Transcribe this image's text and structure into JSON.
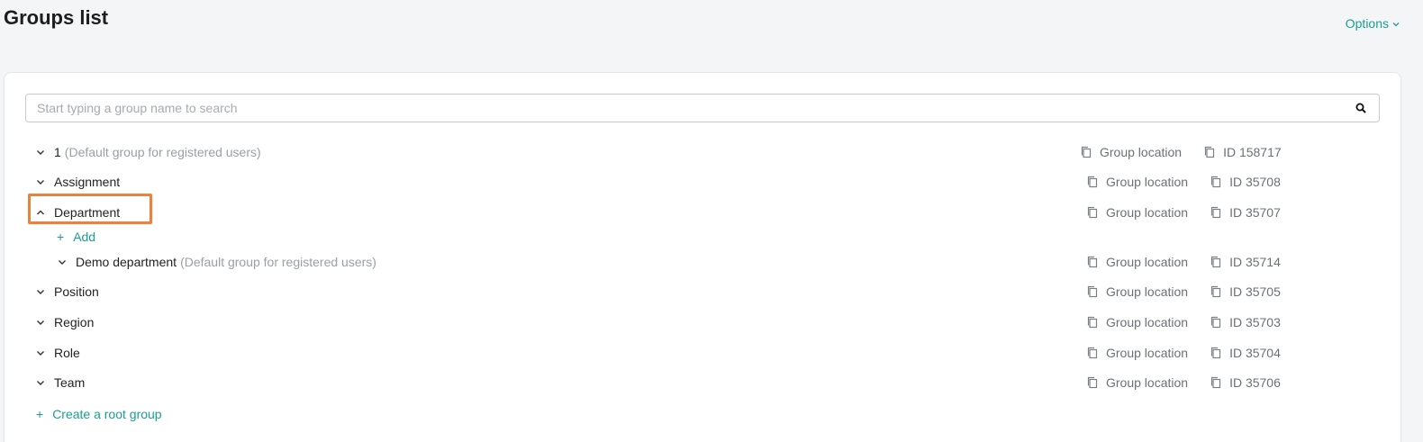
{
  "header": {
    "title": "Groups list",
    "options_label": "Options"
  },
  "search": {
    "placeholder": "Start typing a group name to search",
    "value": ""
  },
  "groups": [
    {
      "name": "1",
      "desc": "(Default group for registered users)",
      "location": "Group location",
      "id": "ID 158717",
      "expanded": false
    },
    {
      "name": "Assignment",
      "desc": "",
      "location": "Group location",
      "id": "ID 35708",
      "expanded": false
    },
    {
      "name": "Department",
      "desc": "",
      "location": "Group location",
      "id": "ID 35707",
      "expanded": true
    },
    {
      "name": "Demo department",
      "desc": "(Default group for registered users)",
      "location": "Group location",
      "id": "ID 35714",
      "expanded": false
    },
    {
      "name": "Position",
      "desc": "",
      "location": "Group location",
      "id": "ID 35705",
      "expanded": false
    },
    {
      "name": "Region",
      "desc": "",
      "location": "Group location",
      "id": "ID 35703",
      "expanded": false
    },
    {
      "name": "Role",
      "desc": "",
      "location": "Group location",
      "id": "ID 35704",
      "expanded": false
    },
    {
      "name": "Team",
      "desc": "",
      "location": "Group location",
      "id": "ID 35706",
      "expanded": false
    }
  ],
  "add_label": "Add",
  "create_root_label": "Create a root group",
  "colors": {
    "accent": "#1a9e8f",
    "highlight": "#f07f3a"
  },
  "icons": {
    "search": "search-icon",
    "copy": "copy-icon",
    "expand": "chevron-down-icon",
    "collapse": "chevron-up-icon",
    "add": "plus-icon"
  }
}
